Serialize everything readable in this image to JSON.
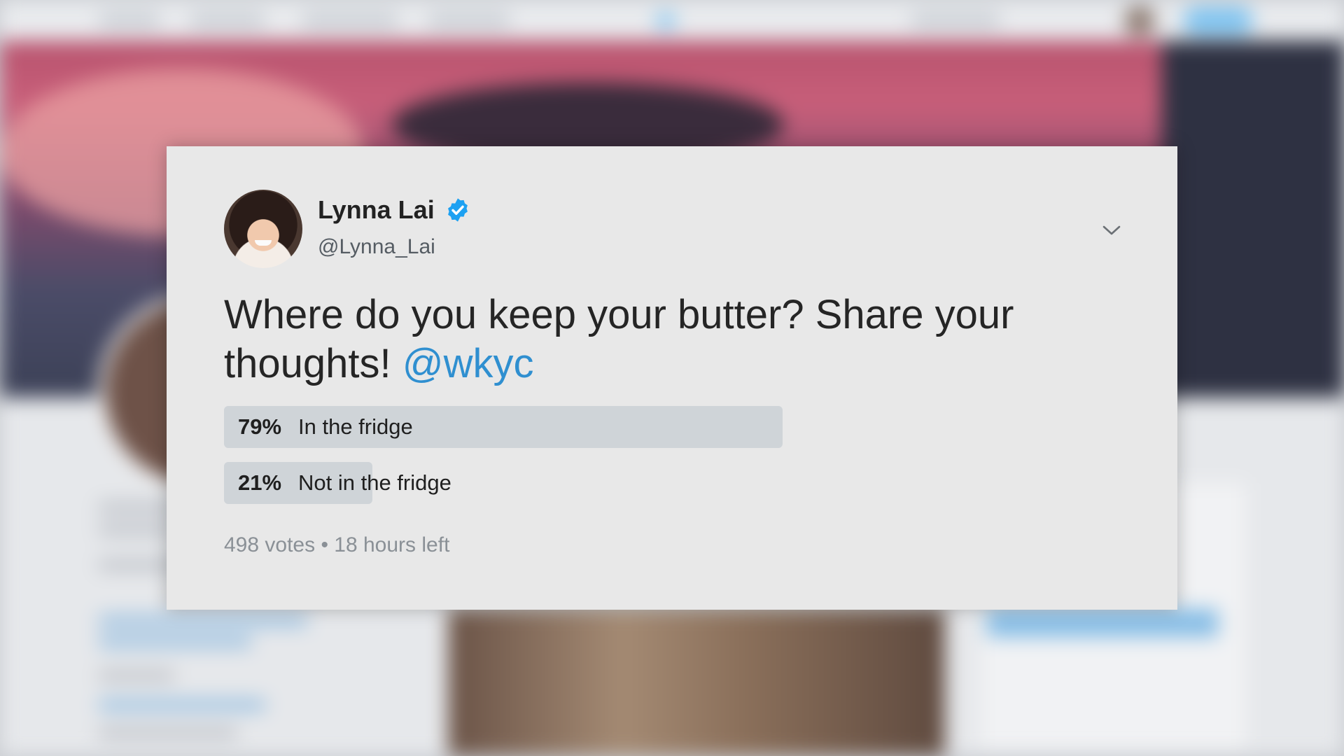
{
  "tweet": {
    "author_name": "Lynna Lai",
    "handle": "@Lynna_Lai",
    "text": "Where do you keep your butter? Share your thoughts! ",
    "mention": "@wkyc",
    "poll": {
      "options": [
        {
          "percent_label": "79%",
          "label": "In the fridge",
          "share": 0.79
        },
        {
          "percent_label": "21%",
          "label": "Not in the fridge",
          "share": 0.21
        }
      ],
      "votes": "498 votes",
      "separator": "•",
      "time_left": "18 hours left"
    },
    "icons": {
      "verified": "verified-badge-icon",
      "menu": "chevron-down-icon"
    }
  },
  "colors": {
    "card_background": "#e8e8e8",
    "mention": "#2f8fd0",
    "verified_badge": "#1da1f2",
    "poll_fill": "#cfd4d8"
  }
}
